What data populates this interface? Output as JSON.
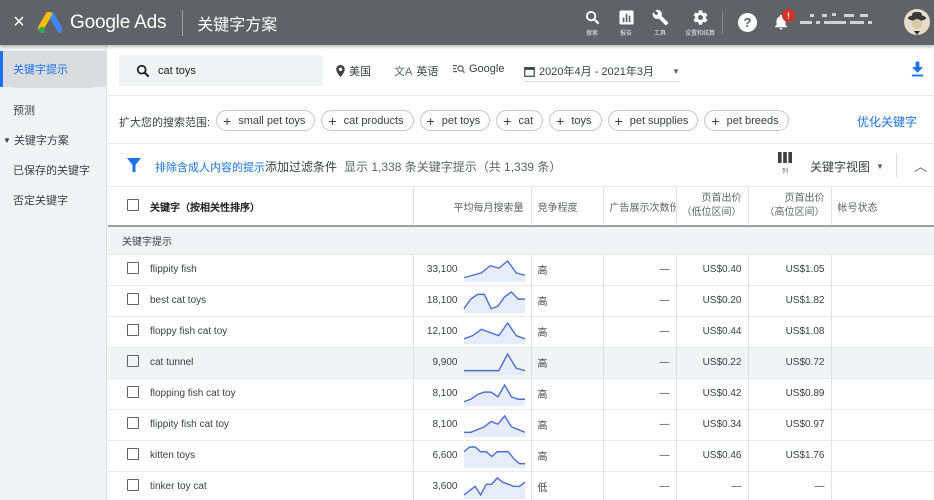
{
  "topbar": {
    "close_label": "×",
    "brand": "Google Ads",
    "page_title": "关键字方案",
    "tools": [
      {
        "icon": "search-icon",
        "label": "搜索"
      },
      {
        "icon": "reports-icon",
        "label": "报告"
      },
      {
        "icon": "wrench-icon",
        "label": "工具"
      },
      {
        "icon": "gear-icon",
        "label": "设置和结算"
      }
    ],
    "help_label": "?",
    "notification_badge": "!"
  },
  "sidebar": {
    "items": [
      {
        "label": "关键字提示",
        "active": true
      },
      {
        "label": "预测"
      },
      {
        "label": "关键字方案",
        "expandable": true
      },
      {
        "label": "已保存的关键字"
      },
      {
        "label": "否定关键字"
      }
    ]
  },
  "search": {
    "value": "cat toys",
    "location": "美国",
    "language": "英语",
    "network": "Google",
    "date_range": "2020年4月 - 2021年3月"
  },
  "broaden": {
    "label": "扩大您的搜索范围:",
    "chips": [
      "small pet toys",
      "cat products",
      "pet toys",
      "cat",
      "toys",
      "pet supplies",
      "pet breeds"
    ],
    "refine_label": "优化关键字"
  },
  "filters": {
    "adult_filter": "排除含成人内容的提示",
    "add_filter": "添加过滤条件",
    "count_text": "显示 1,338 条关键字提示（共 1,339 条）",
    "columns_label": "列",
    "view_label": "关键字视图"
  },
  "table": {
    "headers": {
      "keyword": "关键字（按相关性排序）",
      "volume": "平均每月搜索量",
      "competition": "竞争程度",
      "impression_share": "广告展示次数份额",
      "low_bid_1": "页首出价",
      "low_bid_2": "（低位区间）",
      "high_bid_1": "页首出价",
      "high_bid_2": "（高位区间）",
      "status": "帐号状态"
    },
    "group_label": "关键字提示",
    "rows": [
      {
        "keyword": "flippity fish",
        "volume": "33,100",
        "competition": "高",
        "impression_share": "—",
        "low_bid": "US$0.40",
        "high_bid": "US$1.05",
        "trend": [
          1,
          2,
          3,
          6,
          5,
          8,
          3,
          2
        ],
        "highlight": false
      },
      {
        "keyword": "best cat toys",
        "volume": "18,100",
        "competition": "高",
        "impression_share": "—",
        "low_bid": "US$0.20",
        "high_bid": "US$1.82",
        "trend": [
          1,
          5,
          7,
          7,
          1,
          2,
          6,
          8,
          5,
          5
        ],
        "highlight": false
      },
      {
        "keyword": "floppy fish cat toy",
        "volume": "12,100",
        "competition": "高",
        "impression_share": "—",
        "low_bid": "US$0.44",
        "high_bid": "US$1.08",
        "trend": [
          1,
          2,
          4,
          3,
          2,
          6,
          2,
          1
        ],
        "highlight": false
      },
      {
        "keyword": "cat tunnel",
        "volume": "9,900",
        "competition": "高",
        "impression_share": "—",
        "low_bid": "US$0.22",
        "high_bid": "US$0.72",
        "trend": [
          1,
          1,
          1,
          1,
          1,
          8,
          2,
          1
        ],
        "highlight": true
      },
      {
        "keyword": "flopping fish cat toy",
        "volume": "8,100",
        "competition": "高",
        "impression_share": "—",
        "low_bid": "US$0.42",
        "high_bid": "US$0.89",
        "trend": [
          1,
          2,
          4,
          5,
          5,
          3,
          8,
          3,
          2,
          2
        ],
        "highlight": false
      },
      {
        "keyword": "flippity fish cat toy",
        "volume": "8,100",
        "competition": "高",
        "impression_share": "—",
        "low_bid": "US$0.34",
        "high_bid": "US$0.97",
        "trend": [
          1,
          1,
          2,
          3,
          5,
          4,
          7,
          3,
          2,
          1
        ],
        "highlight": false
      },
      {
        "keyword": "kitten toys",
        "volume": "6,600",
        "competition": "高",
        "impression_share": "—",
        "low_bid": "US$0.46",
        "high_bid": "US$1.76",
        "trend": [
          6,
          8,
          8,
          6,
          6,
          4,
          6,
          6,
          6,
          3,
          1,
          1
        ],
        "highlight": false
      },
      {
        "keyword": "tinker toy cat",
        "volume": "3,600",
        "competition": "低",
        "impression_share": "—",
        "low_bid": "—",
        "high_bid": "—",
        "trend": [
          1,
          3,
          5,
          1,
          6,
          6,
          9,
          7,
          6,
          5,
          5,
          7
        ],
        "highlight": false
      }
    ]
  },
  "colors": {
    "topbar": "#5f6368",
    "accent": "#1a73e8",
    "sparkline": "#4a6fd1",
    "sparkline_fill": "#e6ecfa"
  }
}
